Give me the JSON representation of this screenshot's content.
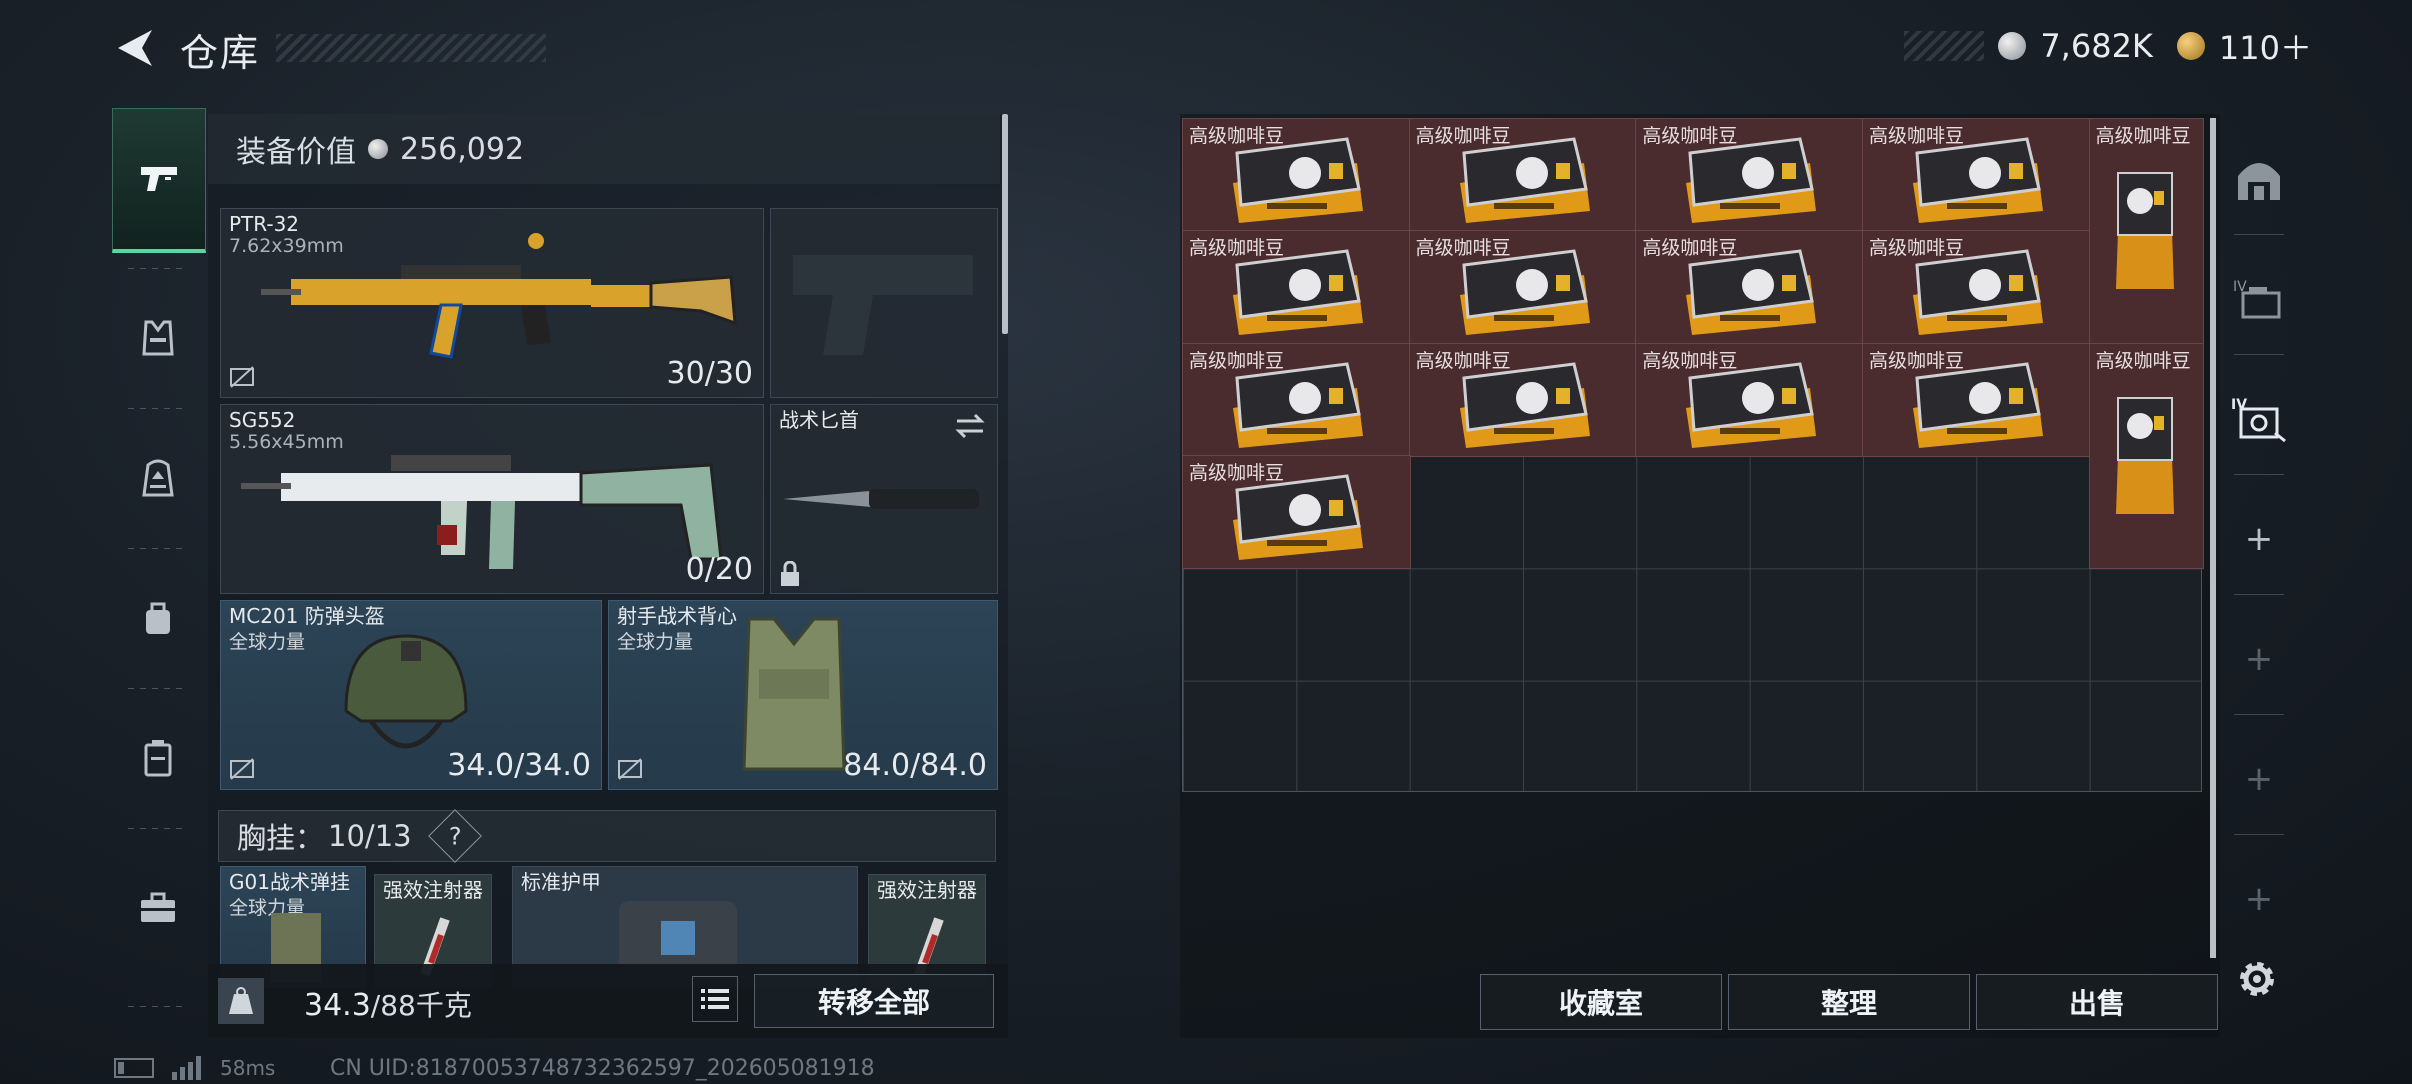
{
  "header": {
    "title": "仓库",
    "silver_amount": "7,682K",
    "gold_amount": "110＋"
  },
  "left_nav": {
    "items": [
      "pistol-icon",
      "vest-icon",
      "backpack-icon",
      "bag-icon",
      "case-icon",
      "toolbox-icon"
    ]
  },
  "equipment": {
    "value_label": "装备价值",
    "value": "256,092",
    "primary1": {
      "name": "PTR-32",
      "caliber": "7.62x39mm",
      "ammo": "30/30"
    },
    "sidearm": {
      "name": ""
    },
    "primary2": {
      "name": "SG552",
      "caliber": "5.56x45mm",
      "ammo": "0/20"
    },
    "melee": {
      "name": "战术匕首"
    },
    "helmet": {
      "name": "MC201 防弹头盔",
      "maker": "全球力量",
      "durability": "34.0/34.0"
    },
    "armor": {
      "name": "射手战术背心",
      "maker": "全球力量",
      "durability": "84.0/84.0"
    },
    "chest_rig": {
      "label": "胸挂：",
      "count": "10/13",
      "help": "?"
    },
    "rig_items": [
      {
        "name": "G01战术弹挂",
        "maker": "全球力量"
      },
      {
        "name": "强效注射器"
      },
      {
        "name": "标准护甲"
      },
      {
        "name": "强效注射器"
      }
    ]
  },
  "weight": {
    "current": "34.3",
    "max": "/88千克"
  },
  "buttons": {
    "transfer_all": "转移全部",
    "collection": "收藏室",
    "organize": "整理",
    "sell": "出售"
  },
  "storage": {
    "item_label": "高级咖啡豆"
  },
  "status": {
    "ping": "58ms",
    "uid": "CN UID:81870053748732362597_202605081918"
  }
}
